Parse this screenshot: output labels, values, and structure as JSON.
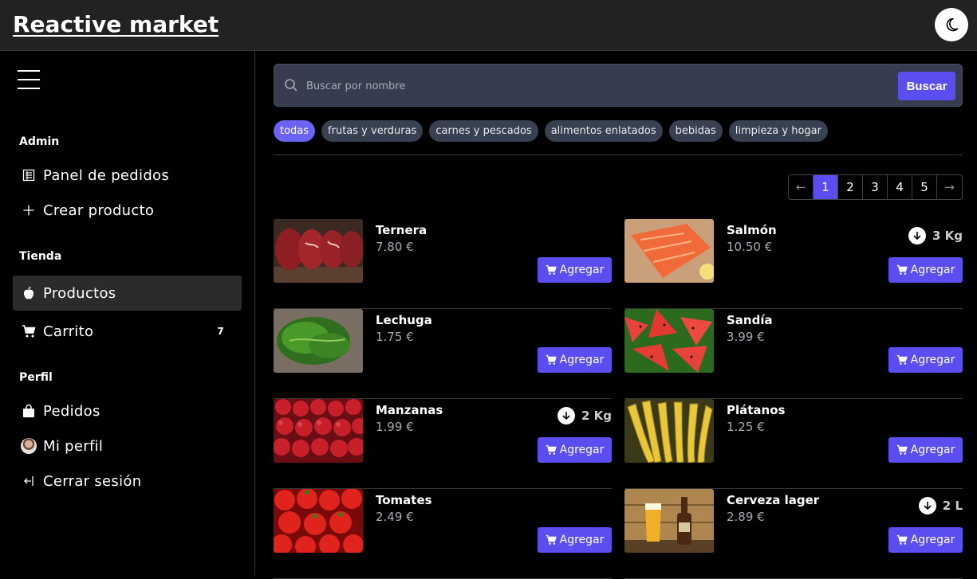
{
  "header": {
    "brand": "Reactive market",
    "theme_icon": "moon-icon"
  },
  "sidebar": {
    "sections": [
      {
        "title": "Admin",
        "items": [
          {
            "label": "Panel de pedidos",
            "icon": "orders-panel-icon"
          },
          {
            "label": "Crear producto",
            "icon": "plus-icon"
          }
        ]
      },
      {
        "title": "Tienda",
        "items": [
          {
            "label": "Productos",
            "icon": "apple-icon",
            "active": true
          },
          {
            "label": "Carrito",
            "icon": "cart-icon",
            "badge": "7"
          }
        ]
      },
      {
        "title": "Perfil",
        "items": [
          {
            "label": "Pedidos",
            "icon": "bag-icon"
          },
          {
            "label": "Mi perfil",
            "icon": "avatar"
          },
          {
            "label": "Cerrar sesión",
            "icon": "logout-icon"
          }
        ]
      }
    ]
  },
  "search": {
    "placeholder": "Buscar por nombre",
    "value": "",
    "button": "Buscar"
  },
  "categories": [
    "todas",
    "frutas y verduras",
    "carnes y pescados",
    "alimentos enlatados",
    "bebidas",
    "limpieza y hogar"
  ],
  "active_category": "todas",
  "pagination": {
    "pages": [
      "1",
      "2",
      "3",
      "4",
      "5"
    ],
    "current": "1",
    "prev": "←",
    "next": "→"
  },
  "add_label": "Agregar",
  "products": [
    {
      "name": "Ternera",
      "price": "7.80 €",
      "weight": ""
    },
    {
      "name": "Salmón",
      "price": "10.50 €",
      "weight": "3 Kg"
    },
    {
      "name": "Lechuga",
      "price": "1.75 €",
      "weight": ""
    },
    {
      "name": "Sandía",
      "price": "3.99 €",
      "weight": ""
    },
    {
      "name": "Manzanas",
      "price": "1.99 €",
      "weight": "2 Kg"
    },
    {
      "name": "Plátanos",
      "price": "1.25 €",
      "weight": ""
    },
    {
      "name": "Tomates",
      "price": "2.49 €",
      "weight": ""
    },
    {
      "name": "Cerveza lager",
      "price": "2.89 €",
      "weight": "2 L"
    }
  ],
  "colors": {
    "accent": "#5b4ef0",
    "chip": "#374151",
    "chip_active": "#6a63f3",
    "topbar": "#222222"
  }
}
